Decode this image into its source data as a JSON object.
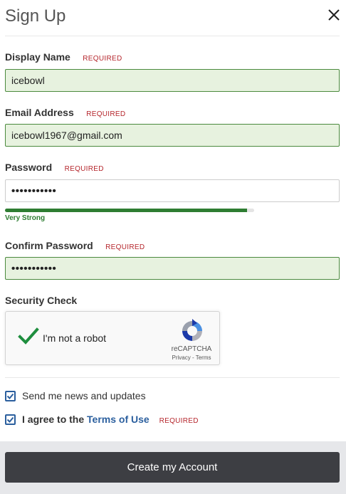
{
  "header": {
    "title": "Sign Up",
    "close_icon": "close-icon"
  },
  "required_text": "REQUIRED",
  "fields": {
    "display_name": {
      "label": "Display Name",
      "value": "icebowl"
    },
    "email": {
      "label": "Email Address",
      "value": "icebowl1967@gmail.com"
    },
    "password": {
      "label": "Password",
      "value": "•••••••••••"
    },
    "confirm_password": {
      "label": "Confirm Password",
      "value": "•••••••••••"
    }
  },
  "password_strength": {
    "label": "Very Strong",
    "fraction": 0.97,
    "color": "#2e7d32"
  },
  "security_check": {
    "label": "Security Check",
    "captcha_text": "I'm not a robot",
    "brand": "reCAPTCHA",
    "links": "Privacy - Terms"
  },
  "options": {
    "newsletter": {
      "label": "Send me news and updates",
      "checked": true
    },
    "terms": {
      "prefix": "I agree to the",
      "link": "Terms of Use",
      "checked": true
    }
  },
  "submit_label": "Create my Account",
  "colors": {
    "valid_bg": "#e7f2df",
    "valid_border": "#4b8a3e",
    "required": "#b5262c",
    "link": "#2b5f9e",
    "button": "#3d3e43"
  }
}
